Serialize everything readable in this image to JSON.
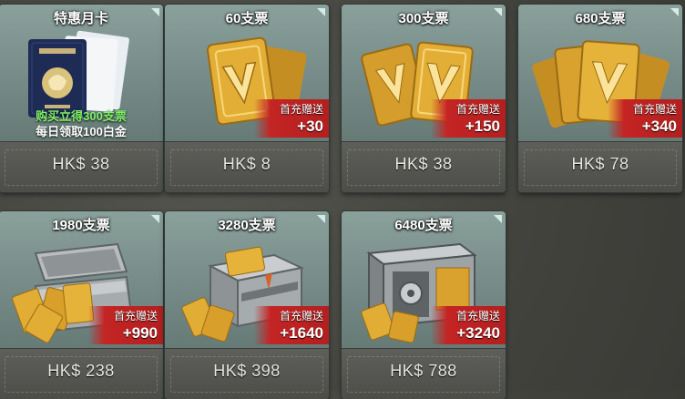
{
  "cards": [
    {
      "title": "特惠月卡",
      "price": "HK$ 38",
      "note_line1": "购买立得300支票",
      "note_line2": "每日领取100白金",
      "icon": "passport-card-icon"
    },
    {
      "title": "60支票",
      "price": "HK$ 8",
      "bonus_label": "首充赠送",
      "bonus_value": "+30",
      "icon": "gold-ticket-icon"
    },
    {
      "title": "300支票",
      "price": "HK$ 38",
      "bonus_label": "首充赠送",
      "bonus_value": "+150",
      "icon": "gold-tickets-icon"
    },
    {
      "title": "680支票",
      "price": "HK$ 78",
      "bonus_label": "首充赠送",
      "bonus_value": "+340",
      "icon": "gold-ticket-stack-icon"
    },
    {
      "title": "1980支票",
      "price": "HK$ 238",
      "bonus_label": "首充赠送",
      "bonus_value": "+990",
      "icon": "open-chest-icon"
    },
    {
      "title": "3280支票",
      "price": "HK$ 398",
      "bonus_label": "首充赠送",
      "bonus_value": "+1640",
      "icon": "metal-crate-icon"
    },
    {
      "title": "6480支票",
      "price": "HK$ 788",
      "bonus_label": "首充赠送",
      "bonus_value": "+3240",
      "icon": "vault-icon"
    }
  ],
  "colors": {
    "bonus_bg": "#c42424",
    "note_green": "#7ef06a",
    "card_top": "#7a8f8a",
    "price_bar": "#555651"
  }
}
